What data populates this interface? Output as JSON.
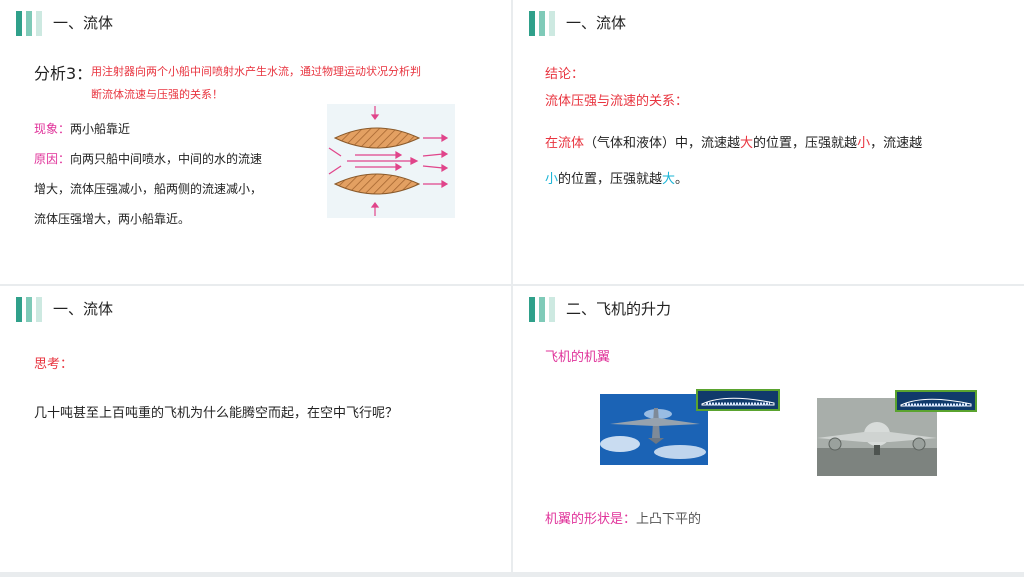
{
  "slide1": {
    "title": "一、流体",
    "analysis_label": "分析3：",
    "analysis_line1": "用注射器向两个小船中间喷射水产生水流，通过物理运动状况分析判",
    "analysis_line2": "断流体流速与压强的关系！",
    "phenomenon_label": "现象：",
    "phenomenon_text": "两小船靠近",
    "reason_label": "原因：",
    "reason_line1": "向两只船中间喷水，中间的水的流速",
    "reason_line2": "增大，流体压强减小，船两侧的流速减小，",
    "reason_line3": "流体压强增大，两小船靠近。"
  },
  "slide2": {
    "title": "一、流体",
    "conclusion_label": "结论：",
    "subtitle": "流体压强与流速的关系：",
    "s_a": "在流体",
    "s_b": "（气体和液体）中，流速越",
    "s_c": "大",
    "s_d": "的位置，压强就越",
    "s_e": "小",
    "s_f": "，流速越",
    "s_g": "小",
    "s_h": "的位置，压强就越",
    "s_i": "大",
    "s_j": "。"
  },
  "slide3": {
    "title": "一、流体",
    "think_label": "思考：",
    "question": "几十吨甚至上百吨重的飞机为什么能腾空而起，在空中飞行呢？"
  },
  "slide4": {
    "title": "二、飞机的升力",
    "wing_label": "飞机的机翼",
    "shape_label": "机翼的形状是：",
    "shape_text": "上凸下平的"
  },
  "colors": {
    "accent_teal": "#2fa08a",
    "red": "#e8343f",
    "pink": "#e0339a",
    "cyan": "#1ab4d6"
  }
}
